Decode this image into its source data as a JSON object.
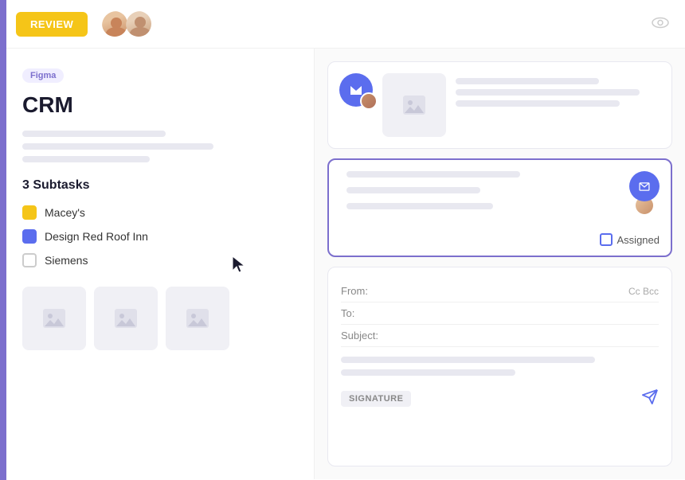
{
  "header": {
    "review_label": "REVIEW",
    "eye_icon_label": "👁"
  },
  "left_panel": {
    "badge": "Figma",
    "title": "CRM",
    "subtasks_header": "3 Subtasks",
    "subtasks": [
      {
        "label": "Macey's",
        "color": "yellow"
      },
      {
        "label": "Design Red Roof Inn",
        "color": "blue"
      },
      {
        "label": "Siemens",
        "color": "gray"
      }
    ],
    "desc_lines": [
      "",
      "",
      ""
    ]
  },
  "right_panel": {
    "email_card_1": {
      "lines": [
        "",
        "",
        ""
      ]
    },
    "email_card_2": {
      "lines": [
        "",
        ""
      ],
      "assigned_label": "Assigned"
    },
    "compose": {
      "from_label": "From:",
      "to_label": "To:",
      "subject_label": "Subject:",
      "cc_bcc_label": "Cc Bcc",
      "signature_label": "SIGNATURE"
    }
  }
}
